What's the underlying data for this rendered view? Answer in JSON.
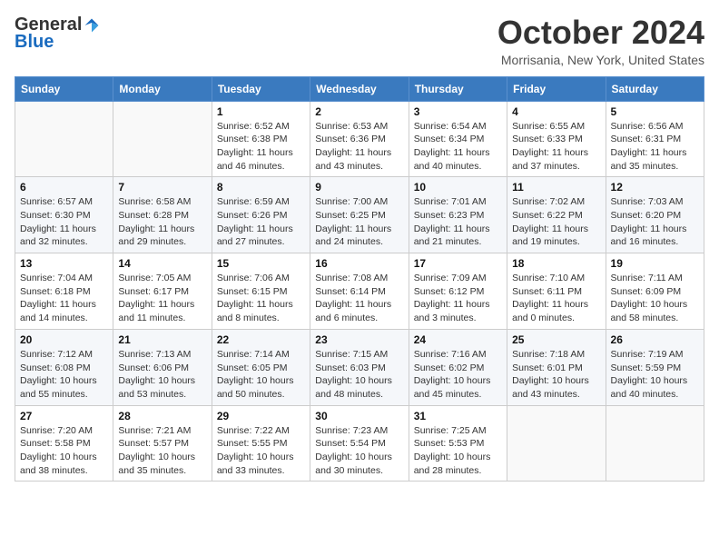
{
  "header": {
    "logo": {
      "general": "General",
      "blue": "Blue",
      "tagline": ""
    },
    "title": "October 2024",
    "location": "Morrisania, New York, United States"
  },
  "weekdays": [
    "Sunday",
    "Monday",
    "Tuesday",
    "Wednesday",
    "Thursday",
    "Friday",
    "Saturday"
  ],
  "weeks": [
    [
      {
        "day": "",
        "sunrise": "",
        "sunset": "",
        "daylight": ""
      },
      {
        "day": "",
        "sunrise": "",
        "sunset": "",
        "daylight": ""
      },
      {
        "day": "1",
        "sunrise": "Sunrise: 6:52 AM",
        "sunset": "Sunset: 6:38 PM",
        "daylight": "Daylight: 11 hours and 46 minutes."
      },
      {
        "day": "2",
        "sunrise": "Sunrise: 6:53 AM",
        "sunset": "Sunset: 6:36 PM",
        "daylight": "Daylight: 11 hours and 43 minutes."
      },
      {
        "day": "3",
        "sunrise": "Sunrise: 6:54 AM",
        "sunset": "Sunset: 6:34 PM",
        "daylight": "Daylight: 11 hours and 40 minutes."
      },
      {
        "day": "4",
        "sunrise": "Sunrise: 6:55 AM",
        "sunset": "Sunset: 6:33 PM",
        "daylight": "Daylight: 11 hours and 37 minutes."
      },
      {
        "day": "5",
        "sunrise": "Sunrise: 6:56 AM",
        "sunset": "Sunset: 6:31 PM",
        "daylight": "Daylight: 11 hours and 35 minutes."
      }
    ],
    [
      {
        "day": "6",
        "sunrise": "Sunrise: 6:57 AM",
        "sunset": "Sunset: 6:30 PM",
        "daylight": "Daylight: 11 hours and 32 minutes."
      },
      {
        "day": "7",
        "sunrise": "Sunrise: 6:58 AM",
        "sunset": "Sunset: 6:28 PM",
        "daylight": "Daylight: 11 hours and 29 minutes."
      },
      {
        "day": "8",
        "sunrise": "Sunrise: 6:59 AM",
        "sunset": "Sunset: 6:26 PM",
        "daylight": "Daylight: 11 hours and 27 minutes."
      },
      {
        "day": "9",
        "sunrise": "Sunrise: 7:00 AM",
        "sunset": "Sunset: 6:25 PM",
        "daylight": "Daylight: 11 hours and 24 minutes."
      },
      {
        "day": "10",
        "sunrise": "Sunrise: 7:01 AM",
        "sunset": "Sunset: 6:23 PM",
        "daylight": "Daylight: 11 hours and 21 minutes."
      },
      {
        "day": "11",
        "sunrise": "Sunrise: 7:02 AM",
        "sunset": "Sunset: 6:22 PM",
        "daylight": "Daylight: 11 hours and 19 minutes."
      },
      {
        "day": "12",
        "sunrise": "Sunrise: 7:03 AM",
        "sunset": "Sunset: 6:20 PM",
        "daylight": "Daylight: 11 hours and 16 minutes."
      }
    ],
    [
      {
        "day": "13",
        "sunrise": "Sunrise: 7:04 AM",
        "sunset": "Sunset: 6:18 PM",
        "daylight": "Daylight: 11 hours and 14 minutes."
      },
      {
        "day": "14",
        "sunrise": "Sunrise: 7:05 AM",
        "sunset": "Sunset: 6:17 PM",
        "daylight": "Daylight: 11 hours and 11 minutes."
      },
      {
        "day": "15",
        "sunrise": "Sunrise: 7:06 AM",
        "sunset": "Sunset: 6:15 PM",
        "daylight": "Daylight: 11 hours and 8 minutes."
      },
      {
        "day": "16",
        "sunrise": "Sunrise: 7:08 AM",
        "sunset": "Sunset: 6:14 PM",
        "daylight": "Daylight: 11 hours and 6 minutes."
      },
      {
        "day": "17",
        "sunrise": "Sunrise: 7:09 AM",
        "sunset": "Sunset: 6:12 PM",
        "daylight": "Daylight: 11 hours and 3 minutes."
      },
      {
        "day": "18",
        "sunrise": "Sunrise: 7:10 AM",
        "sunset": "Sunset: 6:11 PM",
        "daylight": "Daylight: 11 hours and 0 minutes."
      },
      {
        "day": "19",
        "sunrise": "Sunrise: 7:11 AM",
        "sunset": "Sunset: 6:09 PM",
        "daylight": "Daylight: 10 hours and 58 minutes."
      }
    ],
    [
      {
        "day": "20",
        "sunrise": "Sunrise: 7:12 AM",
        "sunset": "Sunset: 6:08 PM",
        "daylight": "Daylight: 10 hours and 55 minutes."
      },
      {
        "day": "21",
        "sunrise": "Sunrise: 7:13 AM",
        "sunset": "Sunset: 6:06 PM",
        "daylight": "Daylight: 10 hours and 53 minutes."
      },
      {
        "day": "22",
        "sunrise": "Sunrise: 7:14 AM",
        "sunset": "Sunset: 6:05 PM",
        "daylight": "Daylight: 10 hours and 50 minutes."
      },
      {
        "day": "23",
        "sunrise": "Sunrise: 7:15 AM",
        "sunset": "Sunset: 6:03 PM",
        "daylight": "Daylight: 10 hours and 48 minutes."
      },
      {
        "day": "24",
        "sunrise": "Sunrise: 7:16 AM",
        "sunset": "Sunset: 6:02 PM",
        "daylight": "Daylight: 10 hours and 45 minutes."
      },
      {
        "day": "25",
        "sunrise": "Sunrise: 7:18 AM",
        "sunset": "Sunset: 6:01 PM",
        "daylight": "Daylight: 10 hours and 43 minutes."
      },
      {
        "day": "26",
        "sunrise": "Sunrise: 7:19 AM",
        "sunset": "Sunset: 5:59 PM",
        "daylight": "Daylight: 10 hours and 40 minutes."
      }
    ],
    [
      {
        "day": "27",
        "sunrise": "Sunrise: 7:20 AM",
        "sunset": "Sunset: 5:58 PM",
        "daylight": "Daylight: 10 hours and 38 minutes."
      },
      {
        "day": "28",
        "sunrise": "Sunrise: 7:21 AM",
        "sunset": "Sunset: 5:57 PM",
        "daylight": "Daylight: 10 hours and 35 minutes."
      },
      {
        "day": "29",
        "sunrise": "Sunrise: 7:22 AM",
        "sunset": "Sunset: 5:55 PM",
        "daylight": "Daylight: 10 hours and 33 minutes."
      },
      {
        "day": "30",
        "sunrise": "Sunrise: 7:23 AM",
        "sunset": "Sunset: 5:54 PM",
        "daylight": "Daylight: 10 hours and 30 minutes."
      },
      {
        "day": "31",
        "sunrise": "Sunrise: 7:25 AM",
        "sunset": "Sunset: 5:53 PM",
        "daylight": "Daylight: 10 hours and 28 minutes."
      },
      {
        "day": "",
        "sunrise": "",
        "sunset": "",
        "daylight": ""
      },
      {
        "day": "",
        "sunrise": "",
        "sunset": "",
        "daylight": ""
      }
    ]
  ]
}
